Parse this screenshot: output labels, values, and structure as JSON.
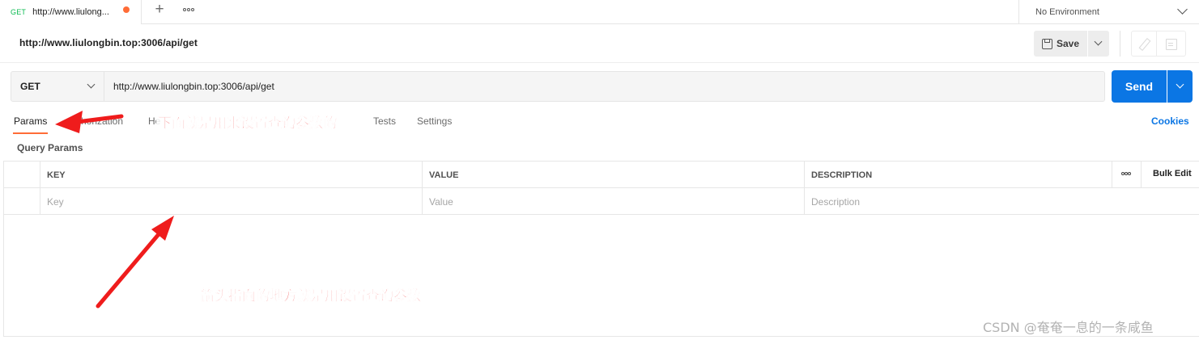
{
  "tabbar": {
    "tab": {
      "method": "GET",
      "title": "http://www.liulongbin.top:3006/api/get",
      "title_display": "http://www.liulong..."
    },
    "new_tab": "+",
    "environment": "No Environment"
  },
  "request": {
    "title": "http://www.liulongbin.top:3006/api/get",
    "save_label": "Save",
    "method": "GET",
    "url": "http://www.liulongbin.top:3006/api/get",
    "send_label": "Send"
  },
  "subtabs": {
    "items": [
      {
        "label": "Params"
      },
      {
        "label": "Authorization",
        "visible": "horization"
      },
      {
        "label": "Headers",
        "visible": "He"
      },
      {
        "label": "Tests"
      },
      {
        "label": "Settings"
      }
    ],
    "active": "Params",
    "cookies": "Cookies"
  },
  "params": {
    "title": "Query Params",
    "columns": [
      "KEY",
      "VALUE",
      "DESCRIPTION"
    ],
    "bulk_edit": "Bulk Edit",
    "placeholders": {
      "key": "Key",
      "value": "Value",
      "description": "Description"
    }
  },
  "annotations": {
    "note1": "下面就是用来设置查询参数的",
    "note2": "箭头指向的地方就是用设置查询参数",
    "color": "#ef1c1c"
  },
  "watermark": "CSDN @奄奄一息的一条咸鱼",
  "colors": {
    "accent": "#ff6c37",
    "send": "#0b76e4",
    "get_method": "#0cbb52"
  }
}
